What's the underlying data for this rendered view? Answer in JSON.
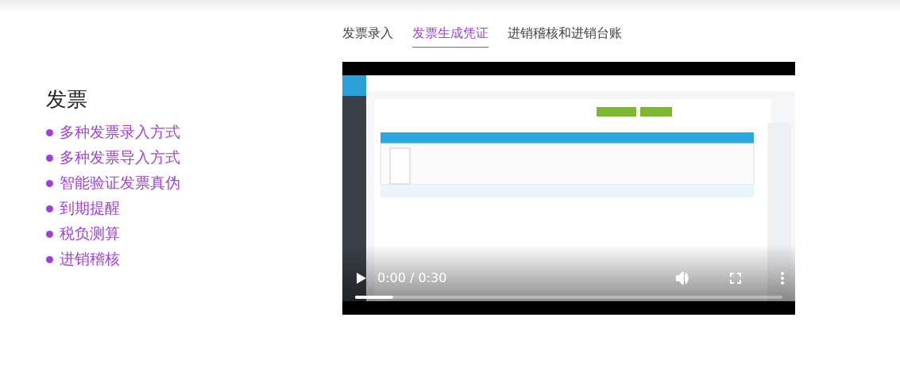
{
  "feature": {
    "title": "发票",
    "items": [
      "多种发票录入方式",
      "多种发票导入方式",
      "智能验证发票真伪",
      "到期提醒",
      "税负测算",
      "进销稽核"
    ]
  },
  "tabs": [
    {
      "label": "发票录入",
      "selected": false
    },
    {
      "label": "发票生成凭证",
      "selected": true
    },
    {
      "label": "进销稽核和进销台账",
      "selected": false
    }
  ],
  "video": {
    "time": "0:00 / 0:30",
    "level": 0.09,
    "playing": false
  }
}
